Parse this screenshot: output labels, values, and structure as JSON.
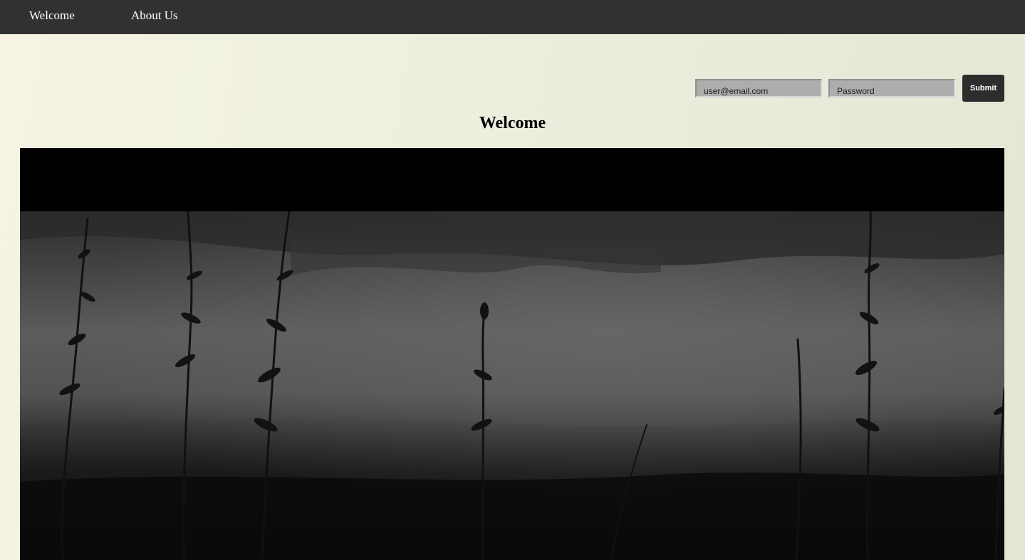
{
  "nav": {
    "items": [
      {
        "label": "Welcome"
      },
      {
        "label": "About Us"
      }
    ]
  },
  "login": {
    "email_placeholder": "user@email.com",
    "password_placeholder": "Password",
    "submit_label": "Submit"
  },
  "main": {
    "title": "Welcome"
  },
  "video": {
    "scene": "misty-field-plants"
  },
  "colors": {
    "navbar": "#303232",
    "button": "#2c2e2e",
    "input_bg": "#adadad",
    "page_bg_start": "#f6f3e4",
    "page_bg_end": "#e2e7d3"
  }
}
